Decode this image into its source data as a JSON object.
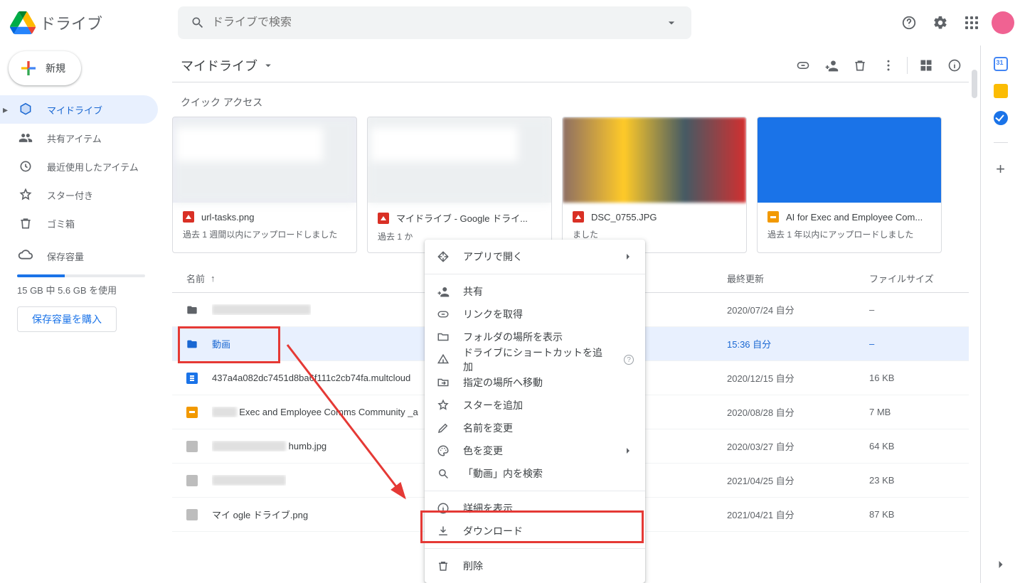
{
  "app_title": "ドライブ",
  "search": {
    "placeholder": "ドライブで検索"
  },
  "new_button": "新規",
  "sidebar": {
    "items": [
      {
        "label": "マイドライブ"
      },
      {
        "label": "共有アイテム"
      },
      {
        "label": "最近使用したアイテム"
      },
      {
        "label": "スター付き"
      },
      {
        "label": "ゴミ箱"
      }
    ],
    "storage_label": "保存容量",
    "storage_used_text": "15 GB 中 5.6 GB を使用",
    "storage_percent": 37,
    "buy_label": "保存容量を購入"
  },
  "breadcrumb": "マイドライブ",
  "quick_access_title": "クイック アクセス",
  "quick_access": [
    {
      "name": "url-tasks.png",
      "reason": "過去 1 週間以内にアップロードしました",
      "type": "img"
    },
    {
      "name": "マイドライブ - Google ドライ...",
      "reason": "過去 1 か",
      "type": "img"
    },
    {
      "name": "DSC_0755.JPG",
      "reason": "ました",
      "type": "img"
    },
    {
      "name": "AI for Exec and Employee Com...",
      "reason": "過去 1 年以内にアップロードしました",
      "type": "slide"
    }
  ],
  "columns": {
    "name": "名前",
    "mod": "最終更新",
    "size": "ファイルサイズ"
  },
  "rows": [
    {
      "name": "",
      "name_blur": "XXXXXXXXXXXXXXXX",
      "mod": "2020/07/24 自分",
      "size": "–",
      "type": "folder"
    },
    {
      "name": "動画",
      "mod": "15:36 自分",
      "size": "–",
      "type": "folder"
    },
    {
      "name": "437a4a082dc7451d8ba6f111c2cb74fa.multcloud",
      "mod": "2020/12/15 自分",
      "size": "16 KB",
      "type": "doc"
    },
    {
      "name": "Exec and Employee Comms Community _a",
      "name_prefix_blur": "XXXX",
      "mod": "2020/08/28 自分",
      "size": "7 MB",
      "type": "slide"
    },
    {
      "name": "humb.jpg",
      "name_prefix_blur": "XXXXXXXXXXXX",
      "mod": "2020/03/27 自分",
      "size": "64 KB",
      "type": "thumb"
    },
    {
      "name": "",
      "name_blur": "XXXXXXXXXXXX",
      "mod": "2021/04/25 自分",
      "size": "23 KB",
      "type": "thumb"
    },
    {
      "name": "マイ            ogle ドライブ.png",
      "mod": "2021/04/21 自分",
      "size": "87 KB",
      "type": "thumb"
    }
  ],
  "ctx": {
    "open_with": "アプリで開く",
    "share": "共有",
    "get_link": "リンクを取得",
    "show_location": "フォルダの場所を表示",
    "add_shortcut": "ドライブにショートカットを追加",
    "move_to": "指定の場所へ移動",
    "add_star": "スターを追加",
    "rename": "名前を変更",
    "change_color": "色を変更",
    "search_within": "「動画」内を検索",
    "view_details": "詳細を表示",
    "download": "ダウンロード",
    "remove": "削除"
  }
}
